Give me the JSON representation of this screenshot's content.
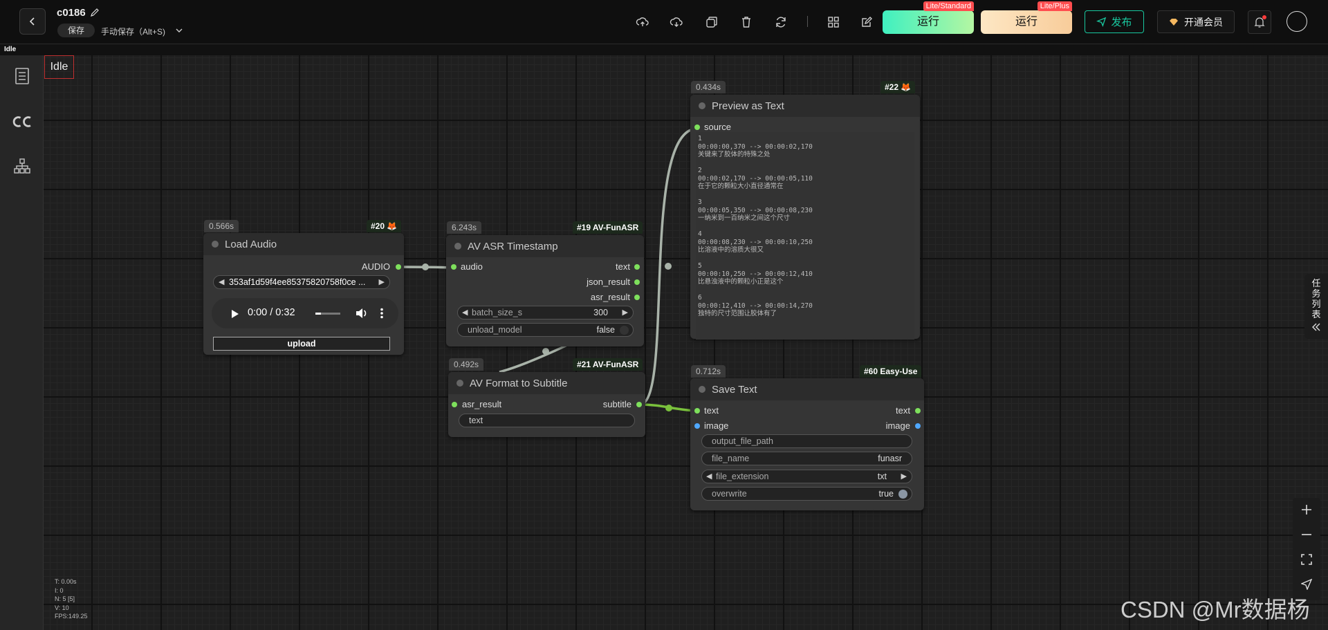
{
  "header": {
    "title": "c0186",
    "save_label": "保存",
    "autosave_label": "手动保存（Alt+S)",
    "run_standard": {
      "label": "运行",
      "badge": "Lite/Standard"
    },
    "run_plus": {
      "label": "运行",
      "badge": "Lite/Plus"
    },
    "publish_label": "发布",
    "vip_label": "开通会员"
  },
  "status": {
    "strip_text": "Idle",
    "canvas_badge": "Idle"
  },
  "nodes": {
    "load_audio": {
      "timing": "0.566s",
      "id": "#20 🦊",
      "title": "Load Audio",
      "output": "AUDIO",
      "file": "353af1d59f4ee85375820758f0ce ...",
      "time": "0:00 / 0:32",
      "upload": "upload"
    },
    "asr": {
      "timing": "6.243s",
      "id": "#19 AV-FunASR",
      "title": "AV ASR Timestamp",
      "input": "audio",
      "outputs": [
        "text",
        "json_result",
        "asr_result"
      ],
      "batch_label": "batch_size_s",
      "batch_value": "300",
      "unload_label": "unload_model",
      "unload_value": "false"
    },
    "format": {
      "timing": "0.492s",
      "id": "#21 AV-FunASR",
      "title": "AV Format to Subtitle",
      "input": "asr_result",
      "output": "subtitle",
      "text_widget": "text"
    },
    "preview": {
      "timing": "0.434s",
      "id": "#22 🦊",
      "title": "Preview as Text",
      "input": "source",
      "content": "1\n00:00:00,370 --> 00:00:02,170\n关键来了胶体的特殊之处\n\n2\n00:00:02,170 --> 00:00:05,110\n在于它的颗粒大小直径通常在\n\n3\n00:00:05,350 --> 00:00:08,230\n一纳米到一百纳米之间这个尺寸\n\n4\n00:00:08,230 --> 00:00:10,250\n比溶液中的溶质大很又\n\n5\n00:00:10,250 --> 00:00:12,410\n比悬浊液中的颗粒小正是这个\n\n6\n00:00:12,410 --> 00:00:14,270\n独特的尺寸范围让胶体有了"
    },
    "save": {
      "timing": "0.712s",
      "id": "#60 Easy-Use",
      "title": "Save Text",
      "inputs": [
        "text",
        "image"
      ],
      "outputs": [
        "text",
        "image"
      ],
      "path_label": "output_file_path",
      "name_label": "file_name",
      "name_value": "funasr",
      "ext_label": "file_extension",
      "ext_value": "txt",
      "overwrite_label": "overwrite",
      "overwrite_value": "true"
    }
  },
  "task_tab": {
    "label": "任务列表"
  },
  "stats": [
    "T: 0.00s",
    "I: 0",
    "N: 5 [5]",
    "V: 10",
    "FPS:149.25"
  ],
  "watermark": "CSDN @Mr数据杨",
  "colors": {
    "run_standard": "#57f2b0",
    "run_plus": "#fbd7a6",
    "publish": "#19c9a0",
    "link_green": "#7ee05c"
  }
}
